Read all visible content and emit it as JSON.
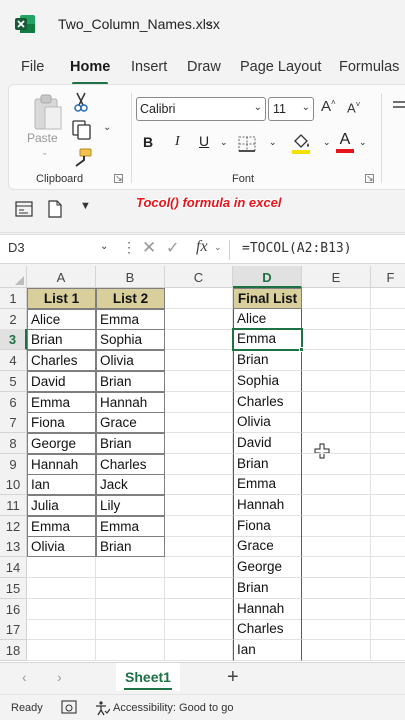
{
  "window": {
    "filename": "Two_Column_Names.xlsx"
  },
  "tabs": [
    {
      "label": "File"
    },
    {
      "label": "Home"
    },
    {
      "label": "Insert"
    },
    {
      "label": "Draw"
    },
    {
      "label": "Page Layout"
    },
    {
      "label": "Formulas"
    }
  ],
  "ribbon": {
    "clipboard": {
      "paste_label": "Paste",
      "group_label": "Clipboard"
    },
    "font": {
      "font_name": "Calibri",
      "font_size": "11",
      "group_label": "Font",
      "bold": "B",
      "italic": "I",
      "underline": "U",
      "grow": "A",
      "shrink": "A",
      "font_color_letter": "A"
    }
  },
  "caption": "Tocol() formula in excel",
  "formula_bar": {
    "name_box": "D3",
    "fx": "fx",
    "formula": "=TOCOL(A2:B13)"
  },
  "grid": {
    "columns": [
      "A",
      "B",
      "C",
      "D",
      "E",
      "F"
    ],
    "selected_column": "D",
    "selected_row": 3,
    "rows": [
      1,
      2,
      3,
      4,
      5,
      6,
      7,
      8,
      9,
      10,
      11,
      12,
      13,
      14,
      15,
      16,
      17,
      18
    ],
    "header_row": {
      "A": "List 1",
      "B": "List 2",
      "D": "Final List"
    },
    "list1": [
      "Alice",
      "Brian",
      "Charles",
      "David",
      "Emma",
      "Fiona",
      "George",
      "Hannah",
      "Ian",
      "Julia",
      "Emma",
      "Olivia"
    ],
    "list2": [
      "Emma",
      "Sophia",
      "Olivia",
      "Brian",
      "Hannah",
      "Grace",
      "Brian",
      "Charles",
      "Jack",
      "Lily",
      "Emma",
      "Brian"
    ],
    "final_list": [
      "Alice",
      "Emma",
      "Brian",
      "Sophia",
      "Charles",
      "Olivia",
      "David",
      "Brian",
      "Emma",
      "Hannah",
      "Fiona",
      "Grace",
      "George",
      "Brian",
      "Hannah",
      "Charles",
      "Ian"
    ]
  },
  "sheets": {
    "active": "Sheet1"
  },
  "status": {
    "ready": "Ready",
    "accessibility": "Accessibility: Good to go"
  },
  "colors": {
    "excel_green": "#1e7145",
    "header_fill": "#d8cf9c",
    "caption_red": "#e8141b"
  }
}
